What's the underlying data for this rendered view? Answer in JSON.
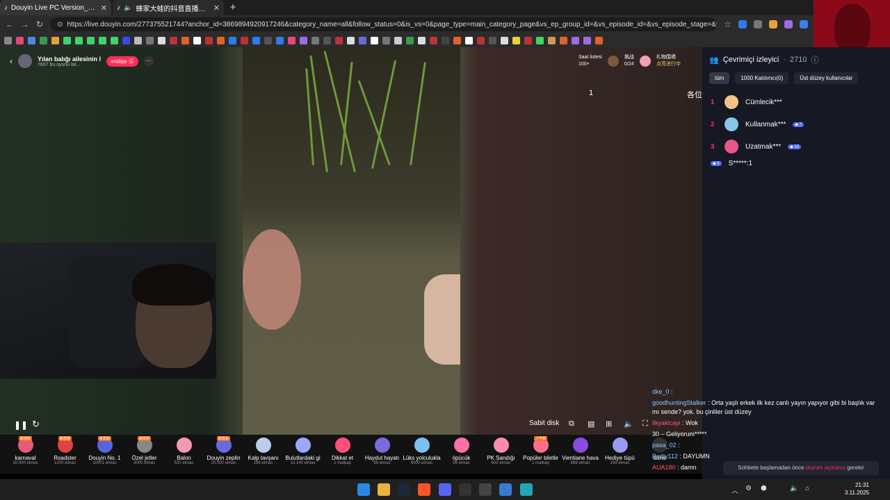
{
  "browser": {
    "tabs": [
      {
        "title": "Douyin Live PC Version_Douyin Li",
        "active": true
      },
      {
        "title": "蜂家大蛙的抖音直播间 - 抖音",
        "active": false
      }
    ],
    "url": "https://live.douyin.com/277375521744?anchor_id=3869894920917246&category_name=all&follow_status=0&is_vs=0&page_type=main_category_page&vs_ep_group_id=&vs_episode_id=&vs_episode_stage=&vs_..."
  },
  "stream": {
    "title": "Yılan balığı ailesinin l",
    "subtitle": "7607 bu oyunu be...",
    "follow_label": "endişe",
    "rank_label": "Saat listesi",
    "rank_value": "100+",
    "progress_label": "0/24",
    "right_label_1": "礼物围墙",
    "right_label_2": "点亮进行中",
    "count_a": "1",
    "count_b": "各位",
    "fixed_disk": "Sabit disk"
  },
  "gifts": [
    {
      "name": "karnaval",
      "price": "30.000 elmas",
      "tag": "新皮肤",
      "color": "#e85a7a"
    },
    {
      "name": "Roadster",
      "price": "1200 elmas",
      "tag": "新皮肤",
      "color": "#d44"
    },
    {
      "name": "Douyin No. 1",
      "price": "10001 elmas",
      "tag": "新皮肤",
      "color": "#5566dd"
    },
    {
      "name": "Özel jetler",
      "price": "3000 elmas",
      "tag": "新皮肤",
      "color": "#888"
    },
    {
      "name": "Balon",
      "price": "520 elmas",
      "tag": "",
      "color": "#f29bb0"
    },
    {
      "name": "Douyin zeplin",
      "price": "20.000 elmas",
      "tag": "新皮肤",
      "color": "#6a6ae0"
    },
    {
      "name": "Kalp tavşanı",
      "price": "299 elmas",
      "tag": "",
      "color": "#bbccee"
    },
    {
      "name": "Bulutlardaki gi",
      "price": "13.140 elmas",
      "tag": "",
      "color": "#9aa6ff"
    },
    {
      "name": "Dikkat et",
      "price": "1 matkap",
      "tag": "",
      "color": "#ff4f7a"
    },
    {
      "name": "Haydut hayatı",
      "price": "99 elmas",
      "tag": "",
      "color": "#7a6adf"
    },
    {
      "name": "Lüks yolculukla",
      "price": "6000 elmas",
      "tag": "",
      "color": "#7ac0f0"
    },
    {
      "name": "öpücük",
      "price": "99 elmas",
      "tag": "",
      "color": "#ff6fa8"
    },
    {
      "name": "PK Sandığı",
      "price": "600 elmas",
      "tag": "",
      "color": "#ff8ab0"
    },
    {
      "name": "Popüler biletle",
      "price": "1 matkap",
      "tag": "人气票",
      "color": "#ff6f8a"
    },
    {
      "name": "Vientiane hava",
      "price": "688 elmas",
      "tag": "",
      "color": "#8a4be0"
    },
    {
      "name": "Hediye tüpü",
      "price": "199 elmas",
      "tag": "",
      "color": "#9a9af0"
    },
    {
      "name": "daha",
      "price": "",
      "tag": "",
      "color": "#333"
    }
  ],
  "sidebar": {
    "viewers_label": "Çevrimiçi izleyici",
    "viewers_count": "2710",
    "tabs": [
      "tüm",
      "1000 Katılımcı(0)",
      "Üst düzey kullanıcılar"
    ],
    "ranks": [
      {
        "num": "1",
        "name": "Cümlecik***",
        "lvl": "",
        "color": "#f2c28a"
      },
      {
        "num": "2",
        "name": "Kullanmak***",
        "lvl": "7",
        "color": "#8ac6e8"
      },
      {
        "num": "3",
        "name": "Uzatmak***",
        "lvl": "15",
        "color": "#e8558a"
      }
    ],
    "extra_user": "S*****:1",
    "extra_lvl": "3"
  },
  "chat": [
    {
      "name": "dke_0",
      "text": ":"
    },
    {
      "name": "goodhuntingStalker",
      "text": ": Orta yaşlı erkek ilk kez canlı yayın yapıyor gibi bi başlık var mı sende? yok. bu çinliler üst düzey"
    },
    {
      "name": "ilkyakicayi",
      "text": ": Wok",
      "red": true
    },
    {
      "name": "",
      "text": "30 – Geliyorum*****"
    },
    {
      "name": "pasa_02",
      "text": ":"
    },
    {
      "name": "Bediy112",
      "text": ": DAYUMN"
    },
    {
      "name": "AUA180",
      "text": ": damn",
      "red": true
    }
  ],
  "chat_input": {
    "pre": "Sohbete başlamadan önce",
    "warn": "oturum açmanız",
    "post": "gerekir"
  },
  "clock": {
    "time": "21:31",
    "date": "3.11.2025"
  }
}
